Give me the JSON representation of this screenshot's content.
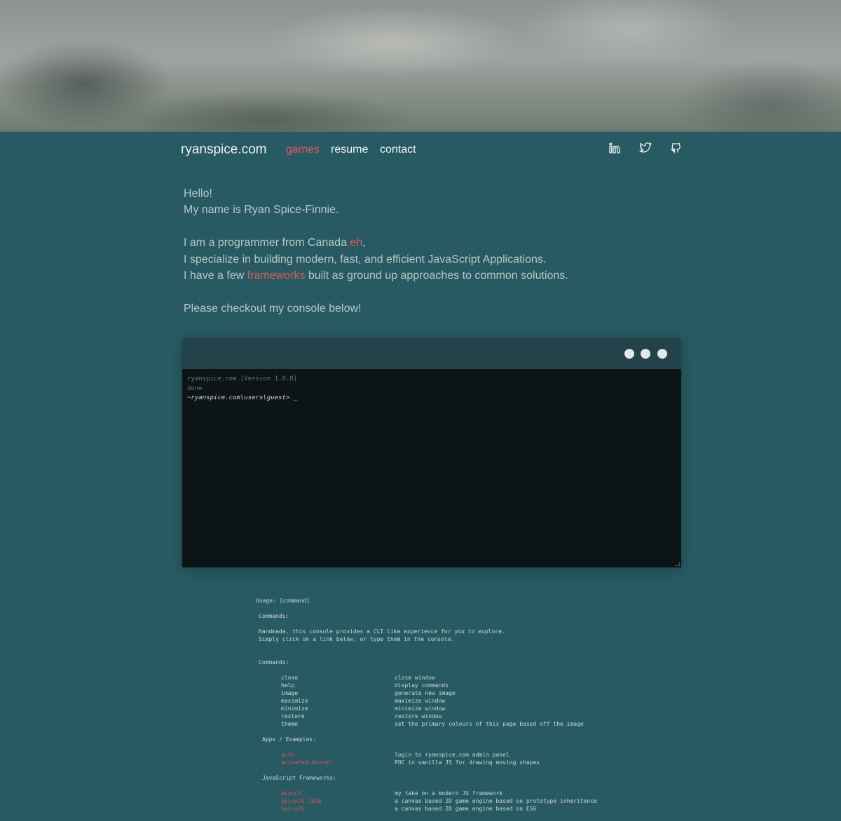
{
  "nav": {
    "brand": "ryanspice.com",
    "links": [
      {
        "label": "games",
        "active": true
      },
      {
        "label": "resume",
        "active": false
      },
      {
        "label": "contact",
        "active": false
      }
    ],
    "social": [
      "linkedin-icon",
      "twitter-icon",
      "github-icon"
    ]
  },
  "intro": {
    "line1": "Hello!",
    "line2": "My name is Ryan Spice-Finnie.",
    "line3_pre": "I am a programmer from Canada ",
    "line3_link": "eh",
    "line3_post": ",",
    "line4": "I specialize in building modern, fast, and efficient JavaScript Applications.",
    "line5_pre": "I have a few ",
    "line5_link": "frameworks",
    "line5_post": " built as ground up approaches to common solutions.",
    "line6": "Please checkout my console below!"
  },
  "console": {
    "version": "ryanspice.com [Version 1.0.8]",
    "status": "done",
    "prompt": "~ryanspice.com\\users\\guest>",
    "cursor": "_"
  },
  "help": {
    "usage": "Usage: [command]",
    "commands_heading": "Commands:",
    "desc1": "Handmade, this console provides a CLI like experience for you to explore.",
    "desc2": "Simply click on a link below, or type them in the console.",
    "commands_heading2": "Commands:",
    "commands": [
      {
        "name": "close",
        "desc": "close window"
      },
      {
        "name": "help",
        "desc": "display commands"
      },
      {
        "name": "image",
        "desc": "generate new image"
      },
      {
        "name": "maximize",
        "desc": "maximize window"
      },
      {
        "name": "minimize",
        "desc": "minimize window"
      },
      {
        "name": "restore",
        "desc": "restore window"
      },
      {
        "name": "theme",
        "desc": "set the primary colours of this page based off the image"
      }
    ],
    "apps_heading": "Apps / Examples:",
    "apps": [
      {
        "name": "auth",
        "desc": "login to ryanspice.com admin panel"
      },
      {
        "name": "animated-banner",
        "desc": "POC in vanilla JS for drawing moving shapes"
      }
    ],
    "frameworks_heading": "JavaScript Frameworks:",
    "frameworks": [
      {
        "name": "AsyncX",
        "desc": "my take on a modern JS framework"
      },
      {
        "name": "SpiceJS-2016",
        "desc": "a canvas based 2D game engine based on prototype inheritence"
      },
      {
        "name": "SpiceJS",
        "desc": "a canvas based 2D game engine based on ES6"
      }
    ]
  },
  "colors": {
    "background": "#275a62",
    "accent": "#e0575f",
    "console_bg": "#0d1415",
    "titlebar": "#23424a"
  }
}
